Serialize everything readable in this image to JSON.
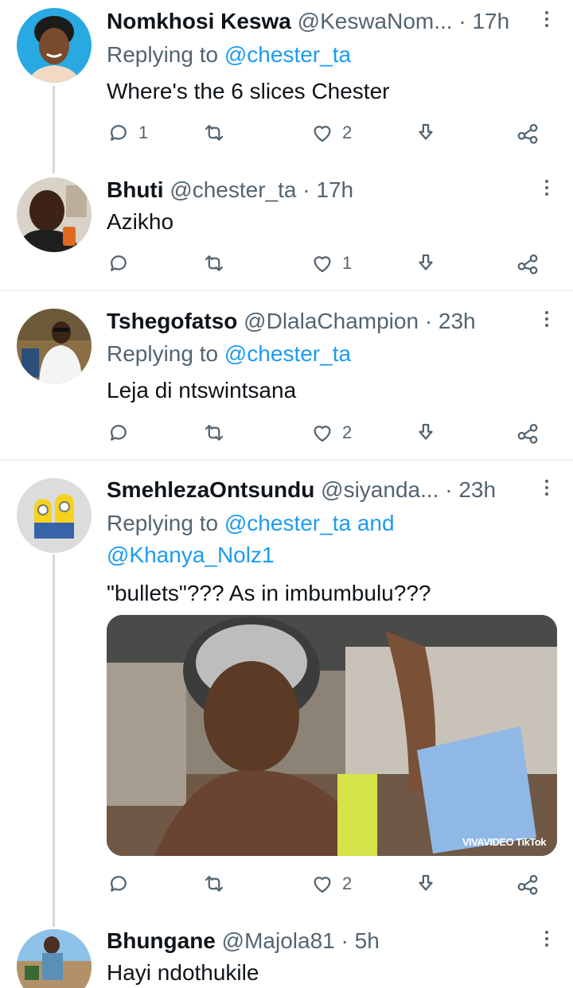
{
  "tweets": [
    {
      "name": "Nomkhosi Keswa",
      "handle": "@KeswaNom...",
      "time": "· 17h",
      "replying_prefix": "Replying to",
      "replying_to": "@chester_ta",
      "replying_joiner": "",
      "replying_to_2": "",
      "text": "Where's the 6 slices Chester",
      "replies": "1",
      "retweets": "",
      "likes": "2"
    },
    {
      "name": "Bhuti",
      "handle": "@chester_ta",
      "time": "· 17h",
      "text": "Azikho",
      "replies": "",
      "retweets": "",
      "likes": "1"
    },
    {
      "name": "Tshegofatso",
      "handle": "@DlalaChampion",
      "time": "· 23h",
      "replying_prefix": "Replying to",
      "replying_to": "@chester_ta",
      "text": "Leja di ntswintsana",
      "replies": "",
      "retweets": "",
      "likes": "2"
    },
    {
      "name": "SmehlezaOntsundu",
      "handle": "@siyanda...",
      "time": "· 23h",
      "replying_prefix": "Replying to",
      "replying_to": "@chester_ta",
      "replying_joiner": "and",
      "replying_to_2": "@Khanya_Nolz1",
      "text": "\"bullets\"??? As in imbumbulu???",
      "media_watermark": "VIVAVIDEO TikTok",
      "replies": "",
      "retweets": "",
      "likes": "2"
    },
    {
      "name": "Bhungane",
      "handle": "@Majola81",
      "time": "· 5h",
      "text": "Hayi ndothukile"
    }
  ],
  "icons": {
    "reply": "reply-icon",
    "retweet": "retweet-icon",
    "like": "heart-icon",
    "download": "download-icon",
    "share": "share-icon",
    "more": "more-icon"
  },
  "colors": {
    "accent": "#1d9bf0",
    "secondary_text": "#536471",
    "primary_text": "#0f1419",
    "divider": "#e6e8ea",
    "thread_line": "#cfd9de"
  }
}
